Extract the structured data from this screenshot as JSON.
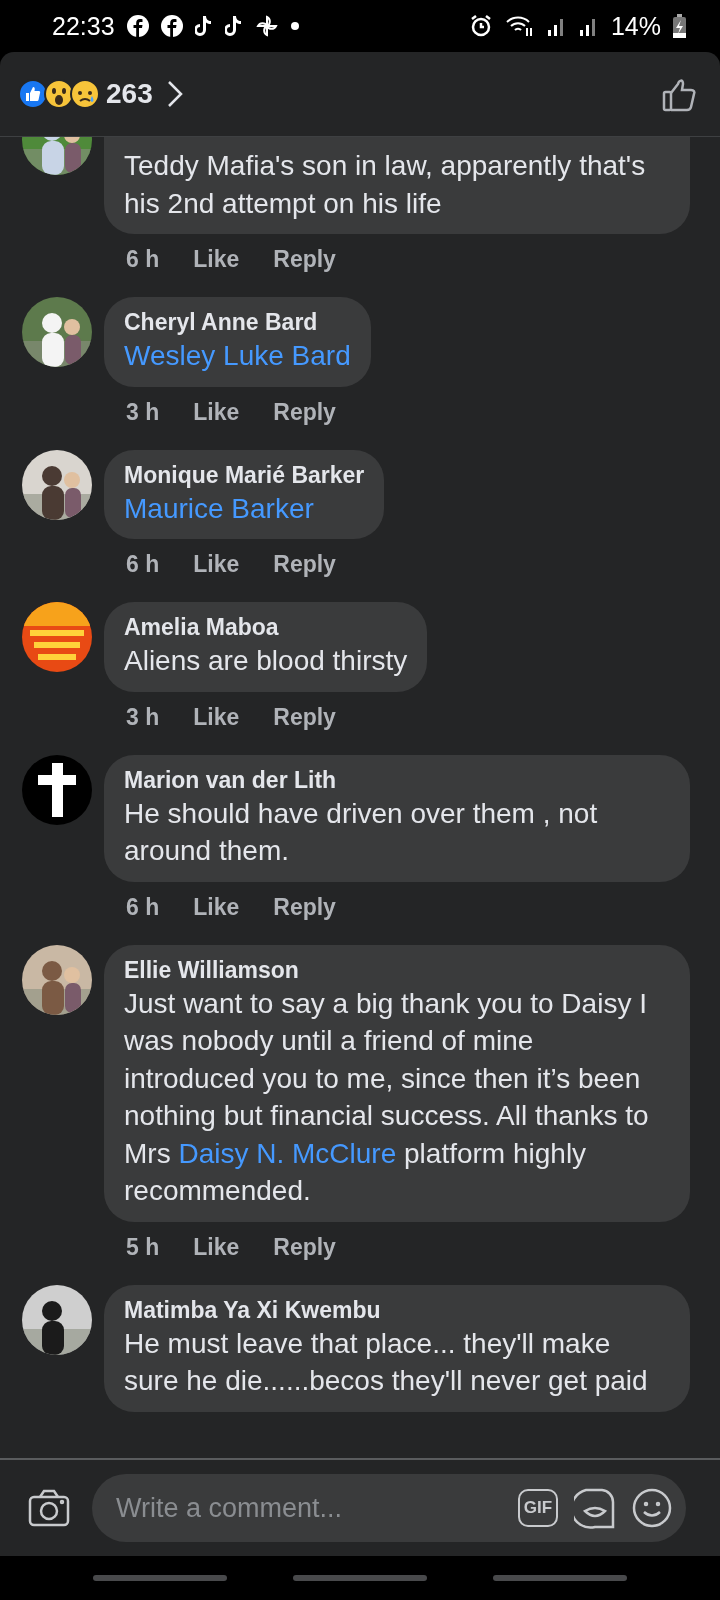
{
  "status_bar": {
    "time": "22:33",
    "battery": "14%"
  },
  "header": {
    "reaction_count": "263"
  },
  "comments": [
    {
      "body": [
        {
          "kind": "text",
          "text": "Teddy Mafia's son in law, apparently that's his 2nd attempt on his life"
        }
      ],
      "time": "6 h",
      "like": "Like",
      "reply": "Reply"
    },
    {
      "name": "Cheryl Anne Bard",
      "body": [
        {
          "kind": "link",
          "text": "Wesley Luke Bard"
        }
      ],
      "time": "3 h",
      "like": "Like",
      "reply": "Reply"
    },
    {
      "name": "Monique Marié Barker",
      "body": [
        {
          "kind": "link",
          "text": "Maurice Barker"
        }
      ],
      "time": "6 h",
      "like": "Like",
      "reply": "Reply"
    },
    {
      "name": "Amelia Maboa",
      "body": [
        {
          "kind": "text",
          "text": "Aliens are blood thirsty"
        }
      ],
      "time": "3 h",
      "like": "Like",
      "reply": "Reply"
    },
    {
      "name": "Marion van der Lith",
      "body": [
        {
          "kind": "text",
          "text": "He should have driven over them , not around them."
        }
      ],
      "time": "6 h",
      "like": "Like",
      "reply": "Reply"
    },
    {
      "name": "Ellie Williamson",
      "body": [
        {
          "kind": "text",
          "text": "Just want to say a big thank you to Daisy I was nobody until a friend of mine introduced you to me, since then it’s been nothing but financial success. All thanks to Mrs "
        },
        {
          "kind": "link",
          "text": "Daisy N. McClure"
        },
        {
          "kind": "text",
          "text": " platform highly recommended."
        }
      ],
      "time": "5 h",
      "like": "Like",
      "reply": "Reply"
    },
    {
      "name": "Matimba Ya Xi Kwembu",
      "body": [
        {
          "kind": "text",
          "text": "He must leave that place... they'll make sure he die......becos they'll never get paid"
        }
      ]
    }
  ],
  "composer": {
    "placeholder": "Write a comment...",
    "gif_label": "GIF"
  }
}
